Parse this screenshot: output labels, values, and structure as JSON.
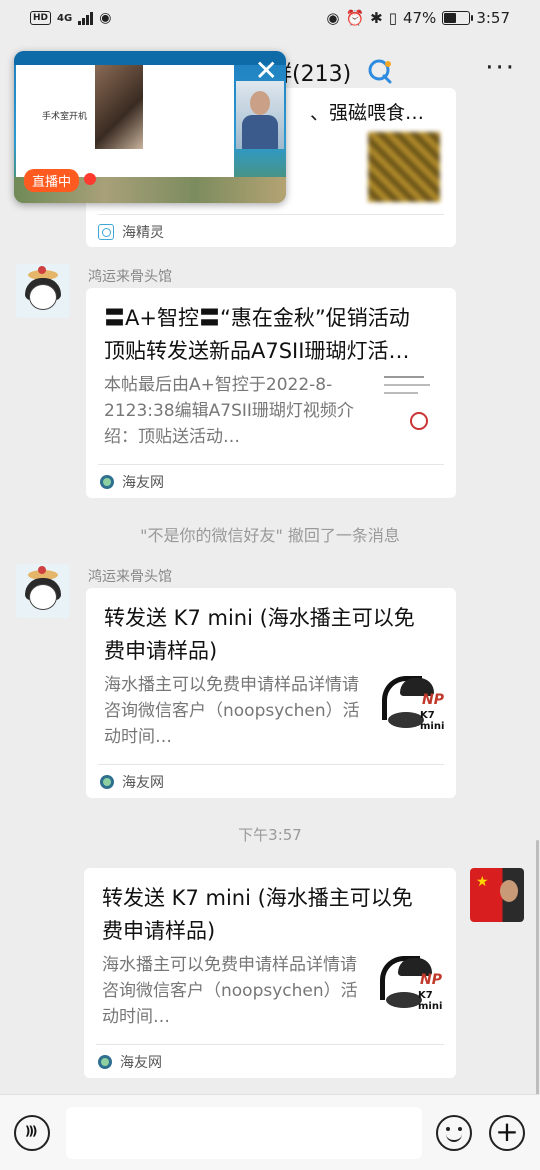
{
  "status_bar": {
    "network": "4G",
    "battery_percent": "47%",
    "battery_level": 0.47,
    "time": "3:57"
  },
  "header": {
    "title": "群(213)",
    "more_label": "···"
  },
  "live_window": {
    "badge": "直播中",
    "slide_text": "手术室开机",
    "close_label": "✕"
  },
  "messages": {
    "partial": {
      "title_fragment": "、强磁喂食…",
      "source": "海精灵"
    },
    "msg1": {
      "sender": "鸿运来骨头馆",
      "title": "〓A+智控〓“惠在金秋”促销活动 顶贴转发送新品A7SII珊瑚灯活…",
      "desc": "本帖最后由A+智控于2022-8-2123:38编辑A7SII珊瑚灯视频介绍：顶贴送活动…",
      "source": "海友网"
    },
    "recall_notice": "\"不是你的微信好友\" 撤回了一条消息",
    "msg2": {
      "sender": "鸿运来骨头馆",
      "title": "转发送 K7 mini (海水播主可以免费申请样品)",
      "desc": "海水播主可以免费申请样品详情请咨询微信客户（noopsychen）活动时间…",
      "source": "海友网",
      "thumb_brand": "NP",
      "thumb_model": "K7 mini"
    },
    "time_divider": "下午3:57",
    "msg3": {
      "title": "转发送 K7 mini (海水播主可以免费申请样品)",
      "desc": "海水播主可以免费申请样品详情请咨询微信客户（noopsychen）活动时间…",
      "source": "海友网",
      "thumb_brand": "NP",
      "thumb_model": "K7 mini"
    }
  },
  "input_bar": {
    "plus_label": "+"
  }
}
